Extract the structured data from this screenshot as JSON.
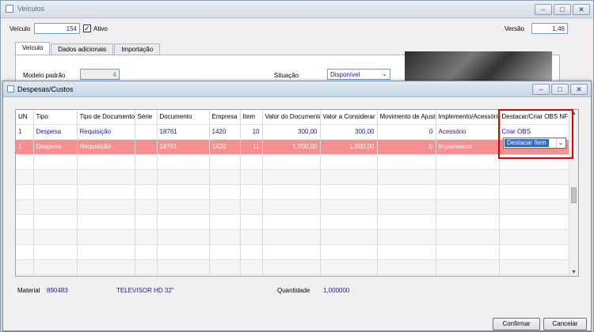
{
  "main_window": {
    "title": "Veículos",
    "veiculo_label": "Veículo",
    "veiculo_value": "154",
    "ativo_label": "Ativo",
    "ativo_checked": true,
    "versao_label": "Versão",
    "versao_value": "1,46",
    "tabs": [
      {
        "label": "Veículo",
        "active": true
      },
      {
        "label": "Dados adicionais",
        "active": false
      },
      {
        "label": "Importação",
        "active": false
      }
    ],
    "modelo_padrao_label": "Modelo padrão",
    "modelo_padrao_value": "4",
    "situacao_label": "Situação",
    "situacao_value": "Disponível"
  },
  "dialog": {
    "title": "Despesas/Custos",
    "columns": [
      "UN",
      "Tipo",
      "Tipo de Documento",
      "Série",
      "Documento",
      "Empresa",
      "Item",
      "Valor do Documento",
      "Valor a Considerar",
      "Movimento de Ajuste",
      "Implemento/Acessório",
      "Destacar/Criar OBS NF"
    ],
    "rows": [
      {
        "un": "1",
        "tipo": "Despesa",
        "tipo_documento": "Requisição",
        "serie": "",
        "documento": "18761",
        "empresa": "1420",
        "item": "10",
        "valor_documento": "300,00",
        "valor_considerar": "300,00",
        "movimento_ajuste": "0",
        "implemento": "Acessório",
        "destacar": "Criar OBS"
      },
      {
        "un": "1",
        "tipo": "Despesa",
        "tipo_documento": "Requisição",
        "serie": "",
        "documento": "18761",
        "empresa": "1420",
        "item": "11",
        "valor_documento": "1.000,00",
        "valor_considerar": "1.000,00",
        "movimento_ajuste": "0",
        "implemento": "Implemento",
        "destacar": "Destacar Item"
      }
    ],
    "footer": {
      "material_label": "Material",
      "material_code": "890483",
      "material_desc": "TELEVISOR HD 32\"",
      "quantidade_label": "Quantidade",
      "quantidade_value": "1,000000"
    },
    "buttons": {
      "confirm": "Confirmar",
      "cancel": "Cancelar"
    }
  },
  "colors": {
    "selected_row": "#f49090",
    "value_text": "#1a1a9c",
    "highlight_box": "#e00000",
    "selection": "#3169c6"
  }
}
